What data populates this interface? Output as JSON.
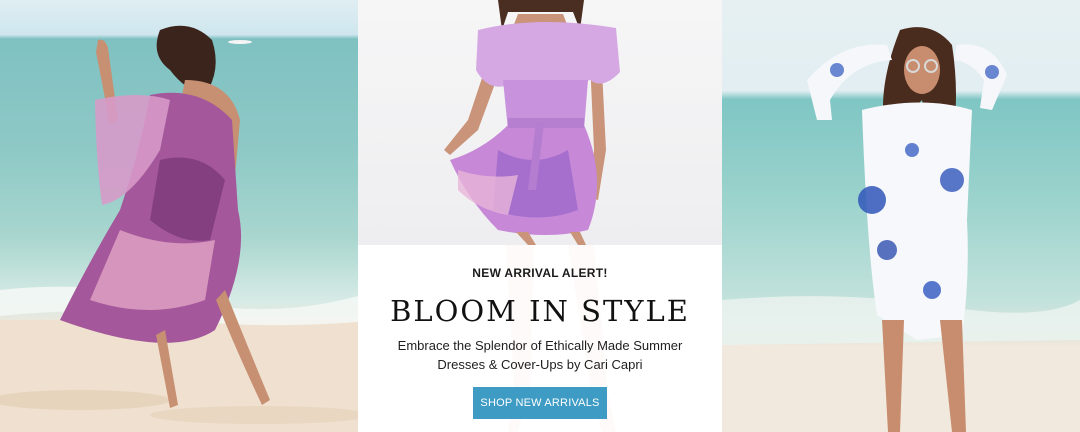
{
  "promo": {
    "eyebrow": "NEW ARRIVAL ALERT!",
    "headline": "BLOOM IN STYLE",
    "subcopy": "Embrace the Splendor of Ethically Made Summer Dresses & Cover-Ups by Cari Capri",
    "cta_label": "SHOP NEW ARRIVALS"
  },
  "colors": {
    "cta_background": "#3d9bc4",
    "cta_text": "#ffffff",
    "headline_text": "#111111"
  }
}
